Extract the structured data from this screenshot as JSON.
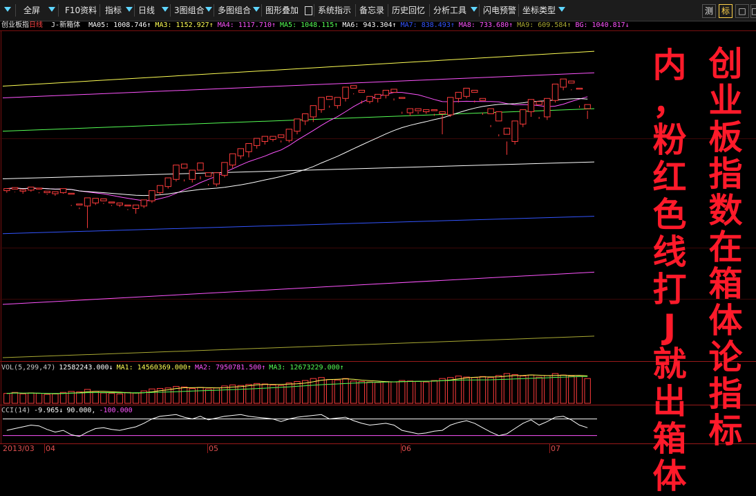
{
  "toolbar": {
    "items": [
      "全屏",
      "F10资料",
      "指标",
      "日线",
      "3图组合",
      "多图组合",
      "图形叠加",
      "系统指示",
      "备忘录",
      "历史回忆",
      "分析工具",
      "闪电预警",
      "坐标类型"
    ],
    "right_buttons": [
      "测",
      "标",
      "□",
      "□"
    ]
  },
  "legend": {
    "name": "创业板指",
    "period": "日线",
    "indicator": "J-新箱体",
    "items": [
      {
        "text": "MA05: 1008.746↑",
        "color": "#ffffff"
      },
      {
        "text": "MA3: 1152.927↑",
        "color": "#ffff55"
      },
      {
        "text": "MA4: 1117.710↑",
        "color": "#ff55ff"
      },
      {
        "text": "MA5: 1048.115↑",
        "color": "#55ff55"
      },
      {
        "text": "MA6: 943.304↑",
        "color": "#ffffff"
      },
      {
        "text": "MA7: 838.493↑",
        "color": "#3355ff"
      },
      {
        "text": "MA8: 733.680↑",
        "color": "#ff55ff"
      },
      {
        "text": "MA9: 609.584↑",
        "color": "#aaaa33"
      },
      {
        "text": "BG: 1040.817↓",
        "color": "#ff55ff"
      }
    ]
  },
  "volume_legend": {
    "items": [
      {
        "text": "VOL(5,299,47)",
        "color": "#c8c8c8"
      },
      {
        "text": "12582243.000↓",
        "color": "#ffffff"
      },
      {
        "text": "MA1: 14560369.000↑",
        "color": "#ffff55"
      },
      {
        "text": "MA2: 7950781.500↑",
        "color": "#ff55ff"
      },
      {
        "text": "MA3: 12673229.000↑",
        "color": "#55ff55"
      }
    ]
  },
  "cci_legend": {
    "items": [
      {
        "text": "CCI(14)",
        "color": "#c8c8c8"
      },
      {
        "text": "-9.965↓",
        "color": "#ffffff"
      },
      {
        "text": "90.000,",
        "color": "#ffffff"
      },
      {
        "text": "-100.000",
        "color": "#ff55ff"
      }
    ]
  },
  "annotations": {
    "col1": [
      "创",
      "业",
      "板",
      "指",
      "数",
      "在",
      "箱",
      "体",
      "论",
      "指",
      "标"
    ],
    "col2": [
      "内",
      "，",
      "粉",
      "红",
      "色",
      "线",
      "打",
      "J",
      "就",
      "出",
      "箱",
      "体"
    ]
  },
  "xaxis_labels": [
    "2013/03",
    "04",
    "05",
    "06",
    "07"
  ],
  "price_labels": {
    "high": "1108.48",
    "low": "817.35"
  },
  "chart_data": {
    "type": "candlestick",
    "title": "创业板指 日线",
    "ylim": [
      560,
      1200
    ],
    "high": 1108.48,
    "low": 817.35,
    "candles": [
      [
        890,
        894,
        886,
        892
      ],
      [
        893,
        896,
        887,
        888
      ],
      [
        889,
        892,
        884,
        890
      ],
      [
        891,
        897,
        888,
        895
      ],
      [
        893,
        895,
        885,
        887
      ],
      [
        886,
        889,
        882,
        884
      ],
      [
        884,
        888,
        880,
        886
      ],
      [
        886,
        894,
        884,
        890
      ],
      [
        883,
        885,
        860,
        862
      ],
      [
        862,
        864,
        854,
        857
      ],
      [
        860,
        876,
        817,
        870
      ],
      [
        866,
        875,
        862,
        872
      ],
      [
        870,
        874,
        864,
        866
      ],
      [
        866,
        868,
        860,
        862
      ],
      [
        862,
        866,
        858,
        864
      ],
      [
        860,
        862,
        852,
        854
      ],
      [
        855,
        862,
        845,
        860
      ],
      [
        860,
        872,
        856,
        870
      ],
      [
        870,
        890,
        866,
        886
      ],
      [
        886,
        900,
        882,
        898
      ],
      [
        898,
        915,
        894,
        912
      ],
      [
        912,
        940,
        908,
        935
      ],
      [
        934,
        942,
        908,
        912
      ],
      [
        912,
        930,
        906,
        928
      ],
      [
        930,
        944,
        912,
        918
      ],
      [
        918,
        925,
        900,
        903
      ],
      [
        903,
        925,
        898,
        920
      ],
      [
        920,
        945,
        916,
        940
      ],
      [
        940,
        962,
        934,
        958
      ],
      [
        958,
        972,
        952,
        968
      ],
      [
        966,
        982,
        955,
        978
      ],
      [
        978,
        992,
        972,
        988
      ],
      [
        986,
        996,
        980,
        992
      ],
      [
        990,
        996,
        986,
        994
      ],
      [
        994,
        999,
        984,
        988
      ],
      [
        988,
        1010,
        984,
        1006
      ],
      [
        1006,
        1030,
        1000,
        1026
      ],
      [
        1026,
        1040,
        1018,
        1034
      ],
      [
        1034,
        1056,
        1024,
        1048
      ],
      [
        1048,
        1072,
        1042,
        1068
      ],
      [
        1068,
        1074,
        1052,
        1056
      ],
      [
        1056,
        1072,
        1050,
        1070
      ],
      [
        1070,
        1092,
        1064,
        1088
      ],
      [
        1090,
        1095,
        1078,
        1080
      ],
      [
        1082,
        1086,
        1060,
        1066
      ],
      [
        1064,
        1074,
        1060,
        1070
      ],
      [
        1070,
        1078,
        1062,
        1074
      ],
      [
        1076,
        1086,
        1070,
        1082
      ],
      [
        1082,
        1088,
        1066,
        1070
      ],
      [
        1070,
        1072,
        1040,
        1044
      ],
      [
        1042,
        1050,
        1036,
        1046
      ],
      [
        1046,
        1050,
        1040,
        1044
      ],
      [
        1044,
        1048,
        1040,
        1046
      ],
      [
        1046,
        1048,
        1036,
        1040
      ],
      [
        1040,
        1044,
        1000,
        1038
      ],
      [
        1038,
        1072,
        1034,
        1068
      ],
      [
        1070,
        1082,
        1062,
        1074
      ],
      [
        1074,
        1090,
        1070,
        1086
      ],
      [
        1082,
        1086,
        1062,
        1066
      ],
      [
        1066,
        1070,
        1038,
        1042
      ],
      [
        1040,
        1050,
        1014,
        1018
      ],
      [
        1026,
        1044,
        996,
        1000
      ],
      [
        1000,
        1012,
        960,
        986
      ],
      [
        986,
        1026,
        980,
        1020
      ],
      [
        1020,
        1048,
        1014,
        1042
      ],
      [
        1044,
        1068,
        1034,
        1058
      ],
      [
        1058,
        1064,
        1030,
        1034
      ],
      [
        1034,
        1070,
        1028,
        1066
      ],
      [
        1066,
        1098,
        1062,
        1094
      ],
      [
        1092,
        1108,
        1086,
        1104
      ],
      [
        1100,
        1104,
        1086,
        1088
      ],
      [
        1088,
        1090,
        1052,
        1056
      ],
      [
        1050,
        1058,
        1030,
        1046
      ]
    ],
    "ma_lines": [
      {
        "name": "MA3",
        "color": "#ffff55",
        "start": 1094,
        "end": 1162
      },
      {
        "name": "MA4",
        "color": "#ff55ff",
        "start": 1071,
        "end": 1120
      },
      {
        "name": "MA5",
        "color": "#55ff55",
        "start": 1006,
        "end": 1050
      },
      {
        "name": "MA6",
        "color": "#ffffff",
        "start": 913,
        "end": 946
      },
      {
        "name": "MA7",
        "color": "#3355ff",
        "start": 806,
        "end": 840
      },
      {
        "name": "MA8",
        "color": "#ff55ff",
        "start": 668,
        "end": 731
      },
      {
        "name": "MA9",
        "color": "#aaaa33",
        "start": 564,
        "end": 606
      }
    ],
    "volume": [
      20,
      22,
      19,
      21,
      20,
      18,
      19,
      22,
      24,
      23,
      28,
      24,
      21,
      20,
      19,
      22,
      21,
      25,
      29,
      30,
      31,
      34,
      33,
      30,
      32,
      29,
      31,
      35,
      37,
      36,
      38,
      40,
      39,
      37,
      36,
      41,
      44,
      46,
      50,
      52,
      48,
      47,
      50,
      45,
      44,
      43,
      42,
      44,
      43,
      46,
      45,
      44,
      43,
      46,
      50,
      52,
      55,
      53,
      52,
      54,
      52,
      56,
      60,
      58,
      55,
      57,
      53,
      56,
      60,
      57,
      55,
      54,
      50
    ],
    "cci": [
      -40,
      -20,
      0,
      20,
      10,
      -30,
      -60,
      -40,
      -90,
      -110,
      -60,
      -20,
      -10,
      -30,
      -40,
      -20,
      0,
      40,
      90,
      120,
      130,
      140,
      110,
      90,
      120,
      80,
      100,
      120,
      130,
      140,
      120,
      110,
      100,
      90,
      60,
      90,
      110,
      120,
      130,
      140,
      90,
      100,
      110,
      70,
      40,
      20,
      30,
      40,
      20,
      -40,
      -60,
      -80,
      -70,
      -50,
      -40,
      20,
      50,
      70,
      40,
      -10,
      -60,
      -100,
      -80,
      -20,
      40,
      80,
      20,
      60,
      110,
      120,
      80,
      20,
      -10
    ]
  }
}
